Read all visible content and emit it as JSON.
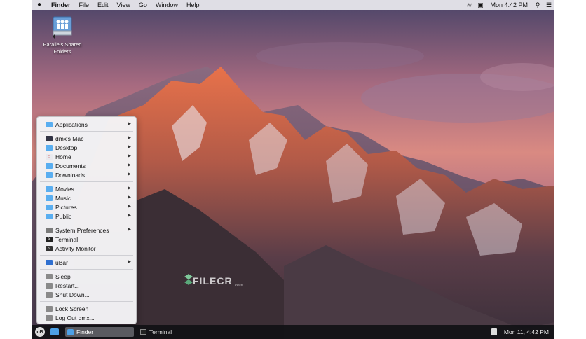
{
  "menubar": {
    "apple_icon": "apple-icon",
    "app_name": "Finder",
    "menus": [
      "File",
      "Edit",
      "View",
      "Go",
      "Window",
      "Help"
    ],
    "clock": "Mon 4:42 PM",
    "status_icons": [
      "parallels-icon",
      "display-icon",
      "search-icon",
      "list-icon"
    ]
  },
  "desktop": {
    "icon_label_line1": "Parallels Shared",
    "icon_label_line2": "Folders"
  },
  "watermark": {
    "text": "FILECR",
    "sub": ".com"
  },
  "start_menu": {
    "sections": [
      [
        {
          "label": "Applications",
          "icon": "folder-icon",
          "submenu": true
        }
      ],
      [
        {
          "label": "dmx's Mac",
          "icon": "computer-icon",
          "submenu": true
        },
        {
          "label": "Desktop",
          "icon": "folder-icon",
          "submenu": true
        },
        {
          "label": "Home",
          "icon": "home-icon",
          "submenu": true
        },
        {
          "label": "Documents",
          "icon": "folder-icon",
          "submenu": true
        },
        {
          "label": "Downloads",
          "icon": "folder-icon",
          "submenu": true
        }
      ],
      [
        {
          "label": "Movies",
          "icon": "folder-icon",
          "submenu": true
        },
        {
          "label": "Music",
          "icon": "folder-icon",
          "submenu": true
        },
        {
          "label": "Pictures",
          "icon": "folder-icon",
          "submenu": true
        },
        {
          "label": "Public",
          "icon": "folder-icon",
          "submenu": true
        }
      ],
      [
        {
          "label": "System Preferences",
          "icon": "gear-icon",
          "submenu": true
        },
        {
          "label": "Terminal",
          "icon": "terminal-icon",
          "submenu": false
        },
        {
          "label": "Activity Monitor",
          "icon": "activity-icon",
          "submenu": false
        }
      ],
      [
        {
          "label": "uBar",
          "icon": "ubar-icon",
          "submenu": true
        }
      ],
      [
        {
          "label": "Sleep",
          "icon": "power-icon",
          "submenu": false
        },
        {
          "label": "Restart...",
          "icon": "power-icon",
          "submenu": false
        },
        {
          "label": "Shut Down...",
          "icon": "power-icon",
          "submenu": false
        }
      ],
      [
        {
          "label": "Lock Screen",
          "icon": "power-icon",
          "submenu": false
        },
        {
          "label": "Log Out dmx...",
          "icon": "power-icon",
          "submenu": false
        }
      ]
    ]
  },
  "taskbar": {
    "start_label": "uB",
    "tasks": [
      {
        "label": "Finder",
        "active": true
      },
      {
        "label": "Terminal",
        "active": false
      }
    ],
    "clock": "Mon 11, 4:42 PM"
  },
  "colors": {
    "folder": "#5aaef0",
    "taskbar": "#121216",
    "menu_bg": "#f4f4f6"
  }
}
